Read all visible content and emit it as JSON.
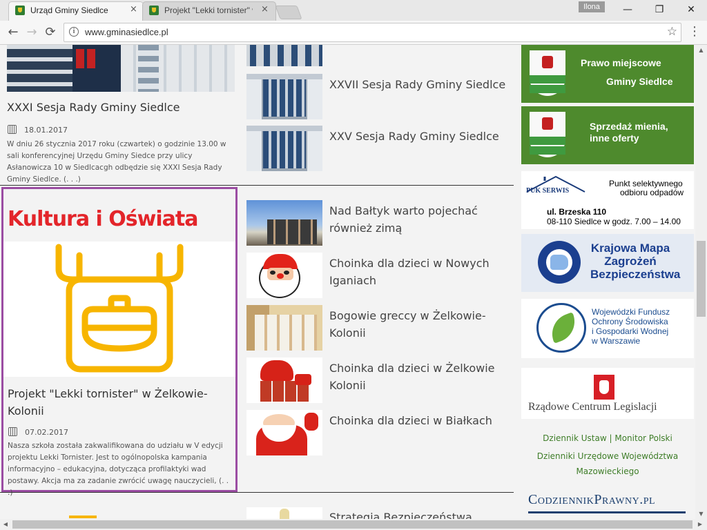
{
  "browser": {
    "tabs": [
      {
        "title": "Urząd Gminy Siedlce",
        "active": true
      },
      {
        "title": "Projekt \"Lekki tornister\" w",
        "active": false
      }
    ],
    "close_glyph": "×",
    "user": "Ilona",
    "window_controls": {
      "minimize": "—",
      "maximize": "❐",
      "close": "✕"
    },
    "nav": {
      "back": "←",
      "forward": "→",
      "reload": "⟳"
    },
    "url": "www.gminasiedlce.pl",
    "info_glyph": "i",
    "star_glyph": "☆",
    "menu_glyph": "⋮"
  },
  "left_column": {
    "featured": {
      "title": "XXXI Sesja Rady Gminy Siedlce",
      "date": "18.01.2017",
      "excerpt": "W dniu 26 stycznia 2017 roku (czwartek) o godzinie 13.00 w sali konferencyjnej Urzędu Gminy Siedce przy ulicy Asłanowicza 10 w Siedlcacgh odbędzie się XXXI Sesja Rady Gminy Siedlce. (. . .)"
    },
    "kultura": {
      "heading": "Kultura i Oświata",
      "title_line1": "Projekt \"Lekki tornister\" w Żelkowie-",
      "title_line2": "Kolonii",
      "date": "07.02.2017",
      "excerpt": "Nasza szkoła została zakwalifikowana do udziału w V edycji projektu Lekki Tornister. Jest to ogólnopolska kampania informacyjno – edukacyjna, dotycząca profilaktyki wad postawy. Akcja ma za zadanie zwrócić uwagę nauczycieli, (. . .)"
    }
  },
  "middle_column": {
    "top_items": [
      {
        "title": "XXVII Sesja Rady Gminy Siedlce"
      },
      {
        "title": "XXV Sesja Rady Gminy Siedlce"
      }
    ],
    "kultura_items": [
      {
        "line1": "Nad Bałtyk warto pojechać",
        "line2": "również zimą"
      },
      {
        "line1": "Choinka dla dzieci w Nowych",
        "line2": "Iganiach"
      },
      {
        "line1": "Bogowie greccy w Żelkowie-",
        "line2": "Kolonii"
      },
      {
        "line1": "Choinka dla dzieci w Żelkowie",
        "line2": "Kolonii"
      },
      {
        "line1": "Choinka dla dzieci w Białkach",
        "line2": ""
      }
    ],
    "bottom_item": "Strategia Bezpieczeństwa"
  },
  "sidebar": {
    "prawo_line1": "Prawo miejscowe",
    "prawo_line2": "Gminy Siedlce",
    "sprzedaz_line1": "Sprzedaż mienia,",
    "sprzedaz_line2": "inne oferty",
    "puk_logo": "PUK SERWIS",
    "puk_line1": "Punkt selektywnego",
    "puk_line2": "odbioru odpadów",
    "puk_address": "ul. Brzeska 110",
    "puk_hours": "08-110 Siedlce w godz. 7.00 – 14.00",
    "kmzb_line1": "Krajowa Mapa",
    "kmzb_line2": "Zagrożeń",
    "kmzb_line3": "Bezpieczeństwa",
    "wfos_line1": "Wojewódzki Fundusz",
    "wfos_line2": "Ochrony Środowiska",
    "wfos_line3": "i Gospodarki Wodnej",
    "wfos_line4": "w Warszawie",
    "rcl": "Rządowe Centrum Legislacji",
    "link_dziennik": "Dziennik Ustaw",
    "link_sep": "|",
    "link_monitor": "Monitor Polski",
    "link_urzedowe1": "Dzienniki Urzędowe Województwa",
    "link_urzedowe2": "Mazowieckiego",
    "codziennik": "CodziennikPrawny.pl"
  },
  "colors": {
    "accent_red": "#e3252a",
    "frame_purple": "#9b4da3",
    "banner_green": "#4e8a2d",
    "link_green": "#3e7d28",
    "backpack_yellow": "#f7b500"
  }
}
